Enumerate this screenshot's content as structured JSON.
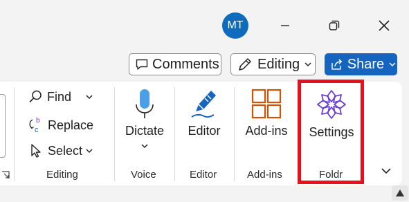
{
  "titlebar": {
    "avatar_initials": "MT",
    "minimize_icon": "minimize-icon",
    "restore_icon": "restore-icon",
    "close_icon": "close-icon"
  },
  "actions": {
    "comments_label": "Comments",
    "editing_label": "Editing",
    "share_label": "Share"
  },
  "ribbon": {
    "editing_group": {
      "find_label": "Find",
      "replace_label": "Replace",
      "select_label": "Select",
      "group_label": "Editing"
    },
    "voice_group": {
      "dictate_label": "Dictate",
      "group_label": "Voice"
    },
    "editor_group": {
      "editor_label": "Editor",
      "group_label": "Editor"
    },
    "addins_group": {
      "addins_label": "Add-ins",
      "group_label": "Add-ins"
    },
    "foldr_group": {
      "settings_label": "Settings",
      "group_label": "Foldr"
    }
  },
  "colors": {
    "accent": "#1565c0",
    "highlight": "#e8101b",
    "addins_orange": "#d35400",
    "foldr_purple": "#6b3fd6"
  }
}
